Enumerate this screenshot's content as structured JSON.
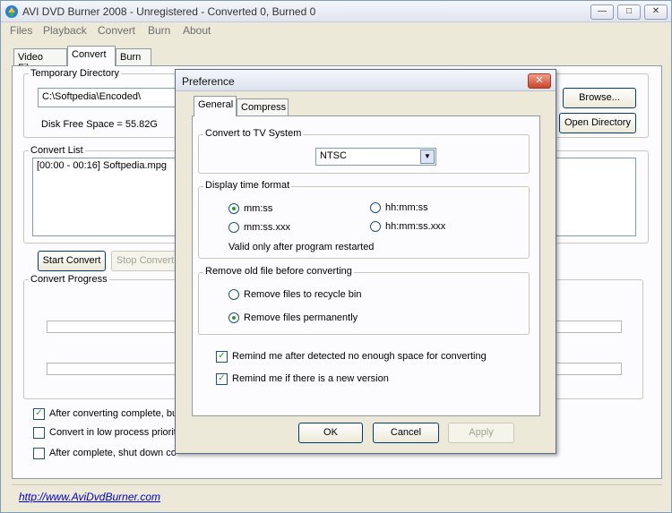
{
  "window": {
    "title": "AVI DVD Burner 2008 - Unregistered - Converted 0, Burned 0",
    "minimize_glyph": "—",
    "maximize_glyph": "□",
    "close_glyph": "✕"
  },
  "menu": [
    "Files",
    "Playback",
    "Convert",
    "Burn",
    "About"
  ],
  "tabs": [
    "Video Files",
    "Convert",
    "Burn"
  ],
  "convert": {
    "temp_dir_label": "Temporary Directory",
    "temp_dir_value": "C:\\Softpedia\\Encoded\\",
    "browse_label": "Browse...",
    "open_dir_label": "Open Directory",
    "disk_free": "Disk Free Space = 55.82G",
    "list_label": "Convert List",
    "list_items": [
      "[00:00 - 00:16] Softpedia.mpg"
    ],
    "start_label": "Start Convert",
    "stop_label": "Stop Convert",
    "progress_label": "Convert Progress",
    "progress1": 0,
    "progress2": 0,
    "options": [
      {
        "label": "After converting complete, bu",
        "checked": true
      },
      {
        "label": "Convert in low process priority",
        "checked": false
      },
      {
        "label": "After complete, shut down co",
        "checked": false
      }
    ],
    "check_glyph": "✓",
    "website": "http://www.AviDvdBurner.com"
  },
  "dialog": {
    "title": "Preference",
    "close_glyph": "✕",
    "tabs": [
      "General",
      "Compress"
    ],
    "tv_system_label": "Convert to TV System",
    "tv_system_value": "NTSC",
    "select_arrow": "▼",
    "time_format_label": "Display time format",
    "time_formats": [
      {
        "label": "mm:ss",
        "selected": true
      },
      {
        "label": "hh:mm:ss",
        "selected": false
      },
      {
        "label": "mm:ss.xxx",
        "selected": false
      },
      {
        "label": "hh:mm:ss.xxx",
        "selected": false
      }
    ],
    "time_note": "Valid only after program restarted",
    "remove_label": "Remove old file before converting",
    "remove_options": [
      {
        "label": "Remove files to recycle bin",
        "selected": false
      },
      {
        "label": "Remove files permanently",
        "selected": true
      }
    ],
    "checks": [
      {
        "label": "Remind me after detected no enough space for converting",
        "checked": true
      },
      {
        "label": "Remind me if there is a new version",
        "checked": true
      }
    ],
    "check_glyph": "✓",
    "ok_label": "OK",
    "cancel_label": "Cancel",
    "apply_label": "Apply"
  },
  "colors": {
    "accent_check": "#21a121",
    "link": "#0000cc"
  }
}
